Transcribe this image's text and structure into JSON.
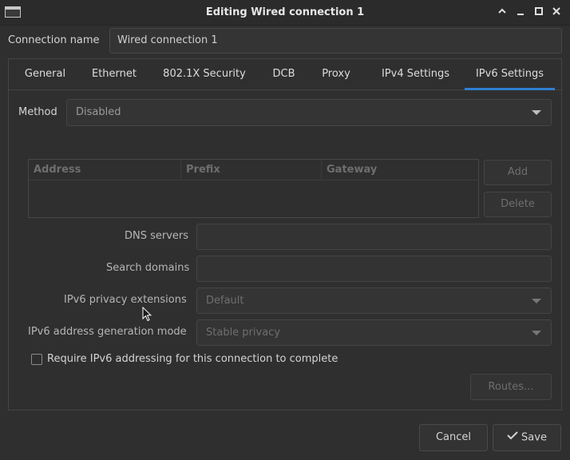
{
  "window": {
    "title": "Editing Wired connection 1",
    "controls": [
      "chevron-up",
      "minimize",
      "maximize",
      "close"
    ]
  },
  "connection": {
    "label": "Connection name",
    "value": "Wired connection 1"
  },
  "tabs": [
    "General",
    "Ethernet",
    "802.1X Security",
    "DCB",
    "Proxy",
    "IPv4 Settings",
    "IPv6 Settings"
  ],
  "active_tab": "IPv6 Settings",
  "ipv6": {
    "method_label": "Method",
    "method_value": "Disabled",
    "table_headers": [
      "Address",
      "Prefix",
      "Gateway"
    ],
    "add_label": "Add",
    "delete_label": "Delete",
    "dns_label": "DNS servers",
    "dns_value": "",
    "search_label": "Search domains",
    "search_value": "",
    "privacy_label": "IPv6 privacy extensions",
    "privacy_value": "Default",
    "addrgen_label": "IPv6 address generation mode",
    "addrgen_value": "Stable privacy",
    "require_label": "Require IPv6 addressing for this connection to complete",
    "require_checked": false,
    "routes_label": "Routes..."
  },
  "footer": {
    "cancel_label": "Cancel",
    "save_label": "Save"
  },
  "colors": {
    "accent": "#2f7fd1",
    "background": "#2f2f2f",
    "text": "#d4d4d4",
    "disabled_text": "#6e6e6e"
  }
}
